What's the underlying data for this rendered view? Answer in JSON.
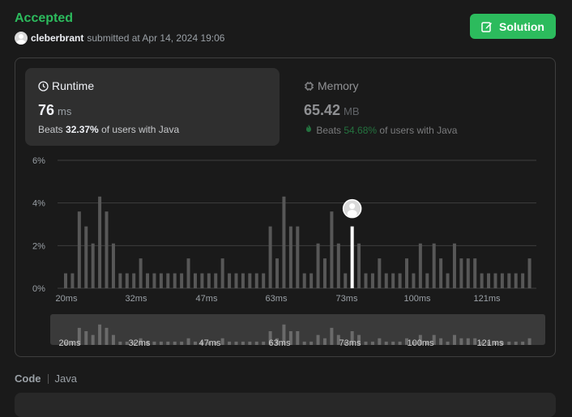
{
  "header": {
    "status": "Accepted",
    "username": "cleberbrant",
    "submitted_text": "submitted at Apr 14, 2024 19:06",
    "solution_label": "Solution"
  },
  "runtime": {
    "label": "Runtime",
    "value": "76",
    "unit": "ms",
    "beats_prefix": "Beats",
    "beats_value": "32.37%",
    "beats_suffix": "of users with Java"
  },
  "memory": {
    "label": "Memory",
    "value": "65.42",
    "unit": "MB",
    "beats_prefix": "Beats",
    "beats_value": "54.68%",
    "beats_suffix": "of users with Java"
  },
  "code_section": {
    "label": "Code",
    "language": "Java"
  },
  "colors": {
    "accent": "#2cbb5d",
    "bar": "#575757",
    "highlight": "#ffffff",
    "grid": "#3e3e3e"
  },
  "icons": {
    "solution": "edit-icon",
    "runtime": "clock-icon",
    "memory": "chip-icon",
    "beats_memory": "fire-icon"
  },
  "chart_data": {
    "type": "bar",
    "ylabel": "",
    "xlabel": "",
    "yticks": [
      "6%",
      "4%",
      "2%",
      "0%"
    ],
    "ylim": [
      0,
      6
    ],
    "xticks": [
      "20ms",
      "32ms",
      "47ms",
      "63ms",
      "73ms",
      "100ms",
      "121ms"
    ],
    "values": [
      0.7,
      0.7,
      3.6,
      2.9,
      2.1,
      4.3,
      3.6,
      2.1,
      0.7,
      0.7,
      0.7,
      1.4,
      0.7,
      0.7,
      0.7,
      0.7,
      0.7,
      0.7,
      1.4,
      0.7,
      0.7,
      0.7,
      0.7,
      1.4,
      0.7,
      0.7,
      0.7,
      0.7,
      0.7,
      0.7,
      2.9,
      1.4,
      4.3,
      2.9,
      2.9,
      0.7,
      0.7,
      2.1,
      1.4,
      3.6,
      2.1,
      0.7,
      2.9,
      2.1,
      0.7,
      0.7,
      1.4,
      0.7,
      0.7,
      0.7,
      1.4,
      0.7,
      2.1,
      0.7,
      2.1,
      1.4,
      0.7,
      2.1,
      1.4,
      1.4,
      1.4,
      0.7,
      0.7,
      0.7,
      0.7,
      0.7,
      0.7,
      0.7,
      1.4
    ],
    "highlight_index": 42,
    "highlight_label": "76ms",
    "grid": true,
    "legend": "none"
  }
}
